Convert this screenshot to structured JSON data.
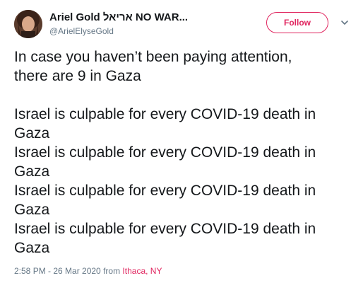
{
  "author": {
    "display_name": "Ariel Gold אריאל NO WAR...",
    "handle": "@ArielElyseGold"
  },
  "follow_button": {
    "label": "Follow"
  },
  "icons": {
    "more": "chevron-down-icon"
  },
  "colors": {
    "accent": "#e0245e",
    "text": "#14171a",
    "secondary": "#657786"
  },
  "tweet": {
    "lines": [
      "In case you haven’t been paying attention,",
      "there are 9 in Gaza",
      "",
      "Israel is culpable for every COVID-19 death in",
      "Gaza",
      "Israel is culpable for every COVID-19 death in",
      "Gaza",
      "Israel is culpable for every COVID-19 death in",
      "Gaza",
      "Israel is culpable for every COVID-19 death in",
      "Gaza"
    ],
    "timestamp": "2:58 PM - 26 Mar 2020",
    "from_label": "from",
    "location": "Ithaca, NY"
  }
}
